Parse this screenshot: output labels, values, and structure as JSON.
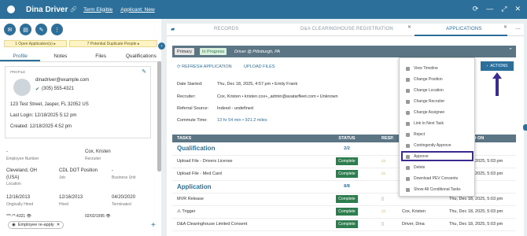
{
  "header": {
    "name": "Dina Driver",
    "term_label": "Term Eligible",
    "applicant_label": "Applicant: New"
  },
  "left": {
    "open_applications": "1 Open Application(s) ▸",
    "duplicates": "7 Potential Duplicate People ▸",
    "tabs": [
      "Profile",
      "Notes",
      "Files",
      "Qualifications"
    ],
    "profile_label": "PROFILE",
    "email": "dinadriver@example.com",
    "phone": "(305) 555-4321",
    "address": "123 Test Street, Jasper, FL 32052 US",
    "last_login": "Last Login: 12/18/2025 5:12 pm",
    "created": "Created: 12/18/2025 4:52 pm",
    "fields": [
      {
        "value": "-",
        "label": "Employee Number"
      },
      {
        "value": "Cox, Kristen",
        "label": "Recruiter"
      },
      {
        "value": "Cleveland, OH",
        "label": "Location"
      },
      {
        "value": "CDL DOT Position",
        "label": "Job"
      },
      {
        "value": "-",
        "label": "Business Unit"
      },
      {
        "value": "(USA)",
        "label": ""
      },
      {
        "value": "12/16/2013",
        "label": "Originally Hired"
      },
      {
        "value": "12/16/2013",
        "label": "Hired"
      },
      {
        "value": "04/20/2020",
        "label": "Terminated"
      },
      {
        "value": "***-**-4321 👁",
        "label": ""
      },
      {
        "value": "02/02/1995 👁",
        "label": ""
      }
    ],
    "tag": "Employee re-apply"
  },
  "right": {
    "tabs": [
      "RECORDS",
      "D&A CLEARINGHOUSE REGISTRATION",
      "APPLICATIONS"
    ],
    "badges": {
      "primary": "Primary",
      "status": "In Progress",
      "title": "Driver @ Pittsburgh, PA"
    },
    "refresh": "REFRESH APPLICATION",
    "upload": "UPLOAD FILES",
    "actions": "ACTIONS",
    "info": [
      {
        "label": "Date Started:",
        "value": "Thu, Dec 18, 2025, 4:57 pm • Emily Frank"
      },
      {
        "label": "Recruiter:",
        "value": "Cox, Kristen • kristen.cox+_admin@avatarfleet.com • Unknown"
      },
      {
        "label": "Referral Source:",
        "value": "Indeed - undefined"
      },
      {
        "label": "Commute Time:",
        "value": "13 hr 54 min • 921.2 miles"
      }
    ],
    "table": {
      "headers": [
        "TASKS",
        "STATUS",
        "RESP.",
        "",
        "COMPLETED ON"
      ],
      "sections": [
        {
          "name": "Qualification",
          "count": "2/2",
          "rows": [
            {
              "task": "Upload File - Drivers License",
              "status": "Complete",
              "resp": "",
              "completed": "Thu, Dec 18, 2025, 5:03 pm"
            },
            {
              "task": "Upload File - Med Card",
              "status": "Complete",
              "resp": "",
              "completed": "Thu, Dec 18, 2025, 5:03 pm"
            }
          ]
        },
        {
          "name": "Application",
          "count": "8/8",
          "rows": [
            {
              "task": "MVR Release",
              "status": "Complete",
              "resp": "",
              "completed": "Thu, Dec 18, 2025, 5:03 pm"
            },
            {
              "task": "⚠ Trigger",
              "status": "Complete",
              "resp": "Cox, Kristen",
              "completed": "Thu, Dec 18, 2025, 5:03 pm"
            },
            {
              "task": "D&A Clearinghouse Limited Consent",
              "status": "Complete",
              "resp": "Driver, Dina",
              "completed": "Thu, Dec 18, 2025, 5:03 pm"
            }
          ]
        }
      ]
    },
    "menu": [
      "View Timeline",
      "Change Position",
      "Change Location",
      "Change Recruiter",
      "Change Assignee",
      "Link to Next Task",
      "Reject",
      "Contingently Approve",
      "Approve",
      "Delete",
      "Download PEV Consents",
      "Show All Conditional Tasks"
    ]
  }
}
